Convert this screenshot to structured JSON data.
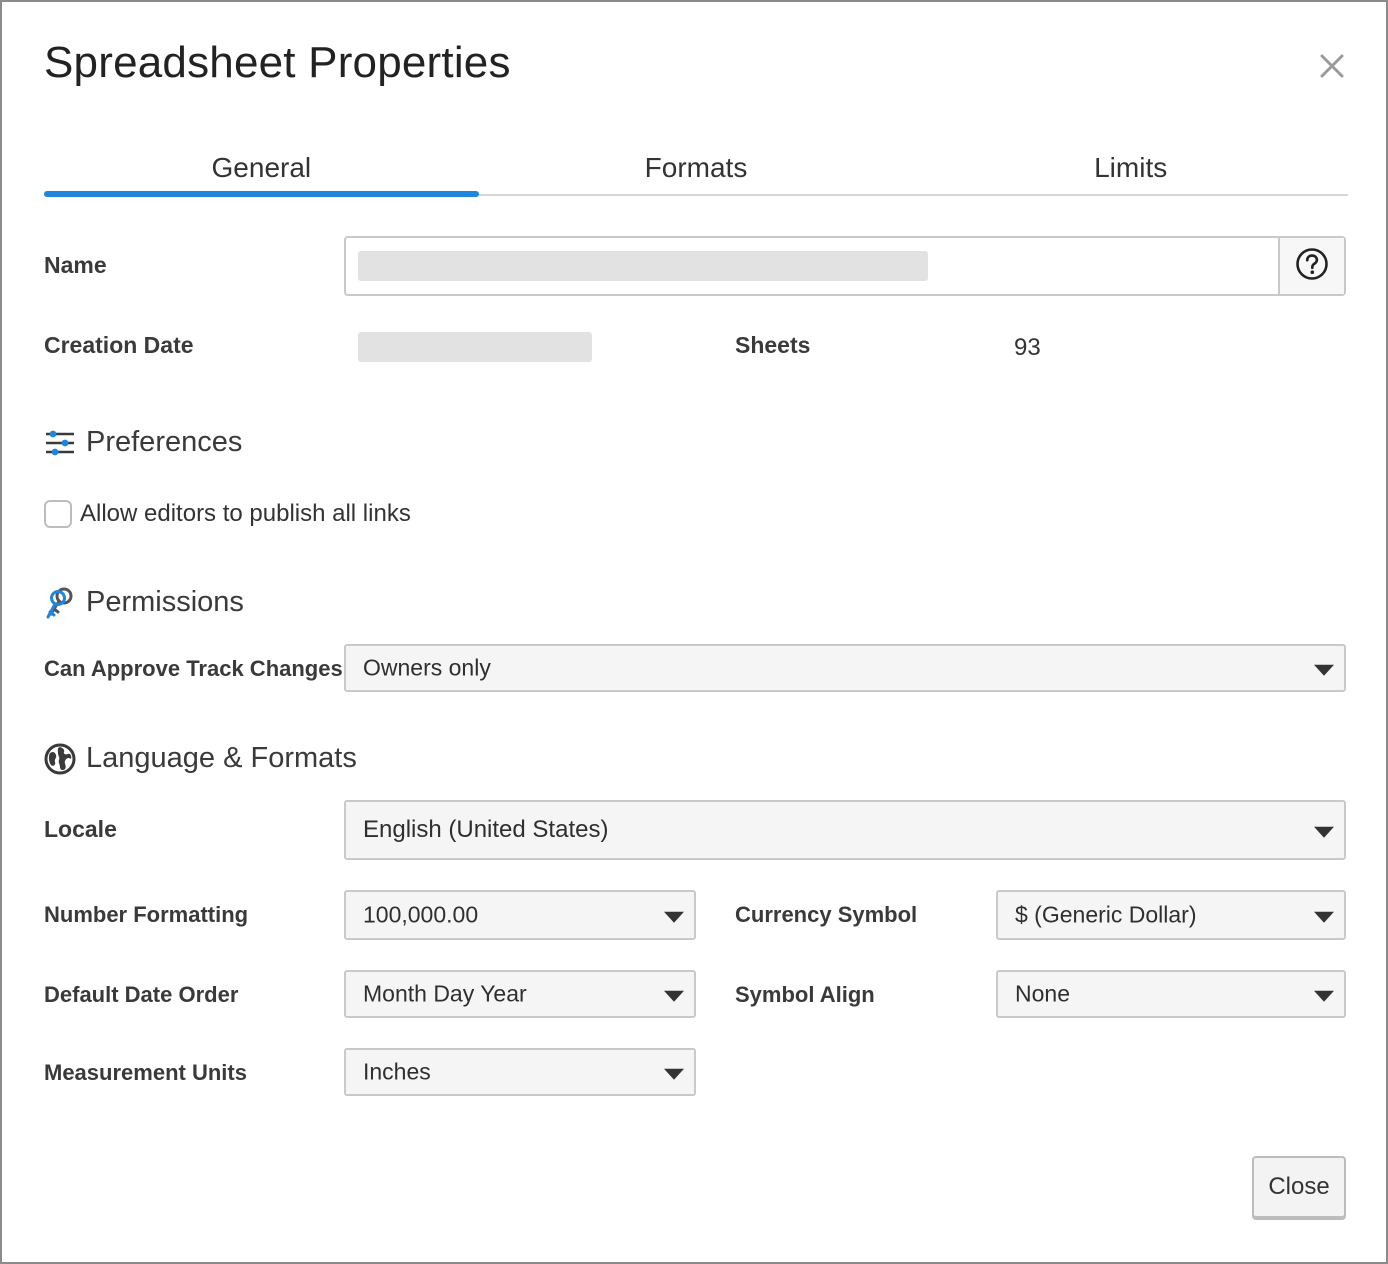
{
  "dialog": {
    "title": "Spreadsheet Properties",
    "close_icon": "close-icon"
  },
  "tabs": [
    {
      "label": "General",
      "active": true
    },
    {
      "label": "Formats",
      "active": false
    },
    {
      "label": "Limits",
      "active": false
    }
  ],
  "general": {
    "name_label": "Name",
    "name_value": "",
    "help_icon": "help-circle-icon",
    "creation_date_label": "Creation Date",
    "creation_date_value": "",
    "sheets_label": "Sheets",
    "sheets_value": "93"
  },
  "preferences": {
    "title": "Preferences",
    "icon": "sliders-icon",
    "allow_publish_label": "Allow editors to publish all links",
    "allow_publish_checked": false
  },
  "permissions": {
    "title": "Permissions",
    "icon": "keys-icon",
    "approve_label": "Can Approve Track Changes",
    "approve_value": "Owners only"
  },
  "language": {
    "title": "Language & Formats",
    "icon": "globe-icon",
    "locale_label": "Locale",
    "locale_value": "English (United States)",
    "number_label": "Number Formatting",
    "number_value": "100,000.00",
    "currency_label": "Currency Symbol",
    "currency_value": "$ (Generic Dollar)",
    "date_order_label": "Default Date Order",
    "date_order_value": "Month Day Year",
    "symbol_align_label": "Symbol Align",
    "symbol_align_value": "None",
    "units_label": "Measurement Units",
    "units_value": "Inches"
  },
  "footer": {
    "close_label": "Close"
  },
  "colors": {
    "accent": "#1f86e0",
    "border": "#c9c9c9"
  }
}
